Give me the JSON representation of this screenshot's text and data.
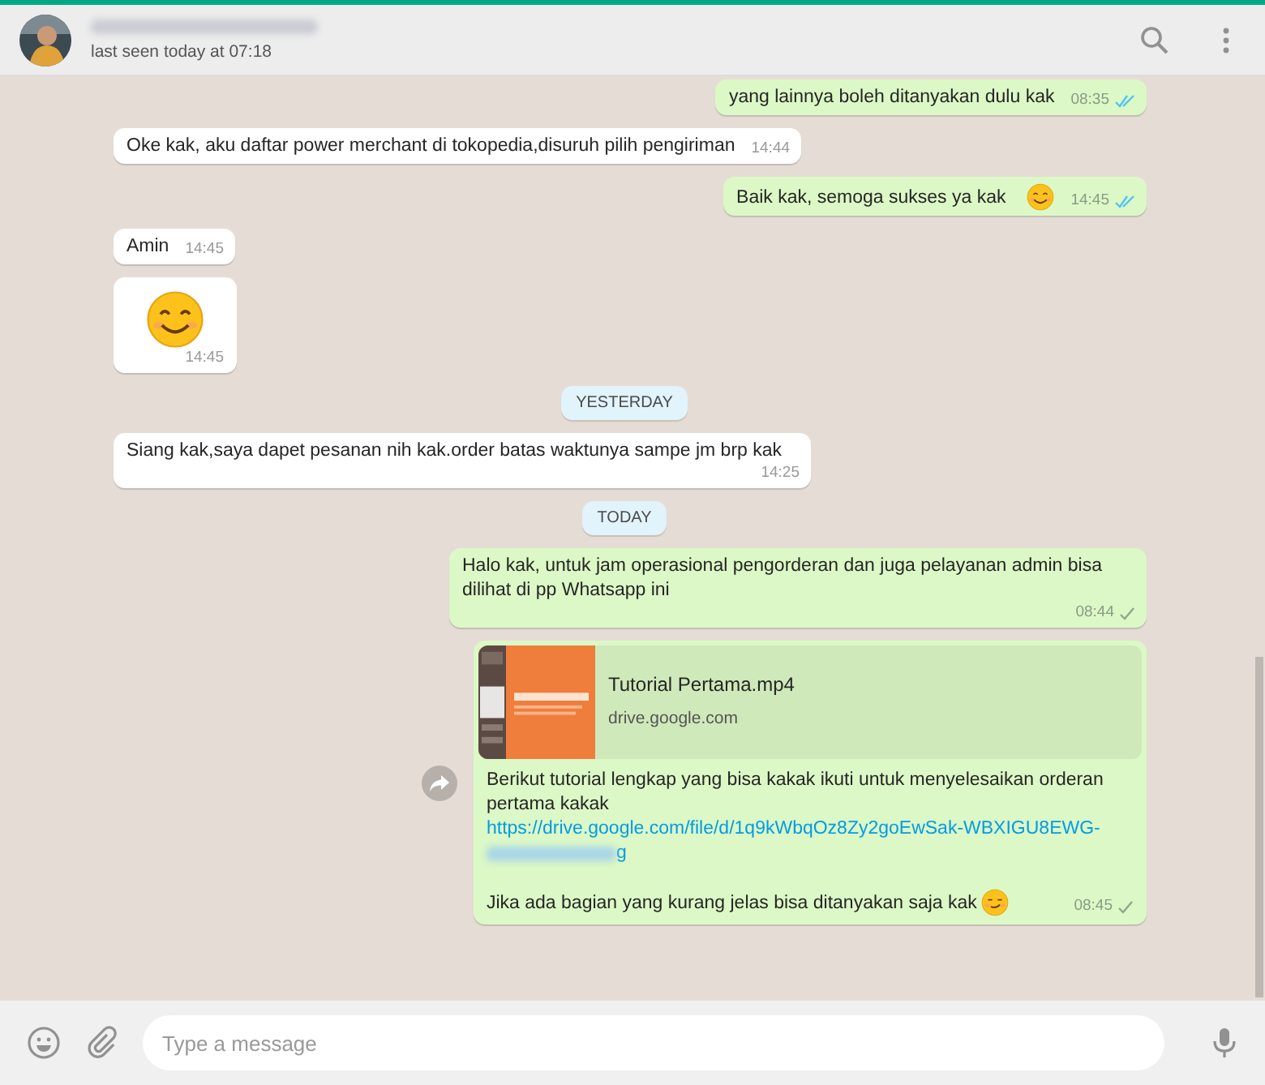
{
  "header": {
    "status": "last seen today at 07:18"
  },
  "messages": [
    {
      "kind": "text",
      "outgoing": true,
      "text": "yang lainnya boleh ditanyakan dulu kak",
      "time": "08:35",
      "read": true
    },
    {
      "kind": "text",
      "outgoing": false,
      "text": "Oke kak, aku daftar power merchant di tokopedia,disuruh pilih pengiriman",
      "time": "14:44"
    },
    {
      "kind": "text",
      "outgoing": true,
      "text": "Baik kak, semoga sukses ya kak",
      "emoji": {
        "kind": "smile"
      },
      "time": "14:45",
      "read": true
    },
    {
      "kind": "text",
      "outgoing": false,
      "text": "Amin",
      "time": "14:45"
    },
    {
      "kind": "emoji",
      "outgoing": false,
      "emoji": {
        "kind": "smile"
      },
      "time": "14:45"
    },
    {
      "kind": "date",
      "label": "YESTERDAY"
    },
    {
      "kind": "text",
      "outgoing": false,
      "text": "Siang kak,saya dapet pesanan nih kak.order batas waktunya sampe jm brp kak",
      "time": "14:25"
    },
    {
      "kind": "date",
      "label": "TODAY"
    },
    {
      "kind": "text",
      "outgoing": true,
      "text": "Halo kak, untuk jam operasional pengorderan dan juga pelayanan admin bisa dilihat di pp Whatsapp ini",
      "time": "08:44",
      "read": false
    },
    {
      "kind": "link",
      "outgoing": true,
      "preview": {
        "title": "Tutorial Pertama.mp4",
        "domain": "drive.google.com"
      },
      "text": "Berikut tutorial lengkap yang bisa kakak ikuti untuk menyelesaikan orderan pertama kakak",
      "link": "https://drive.google.com/file/d/1q9kWbqOz8Zy2goEwSak-WBXIGU8EWG-",
      "link_tail": "g",
      "note": "Jika ada bagian yang kurang jelas bisa ditanyakan saja kak",
      "emoji": {
        "kind": "wink"
      },
      "time": "08:45",
      "read": false
    }
  ],
  "composer": {
    "placeholder": "Type a message"
  }
}
